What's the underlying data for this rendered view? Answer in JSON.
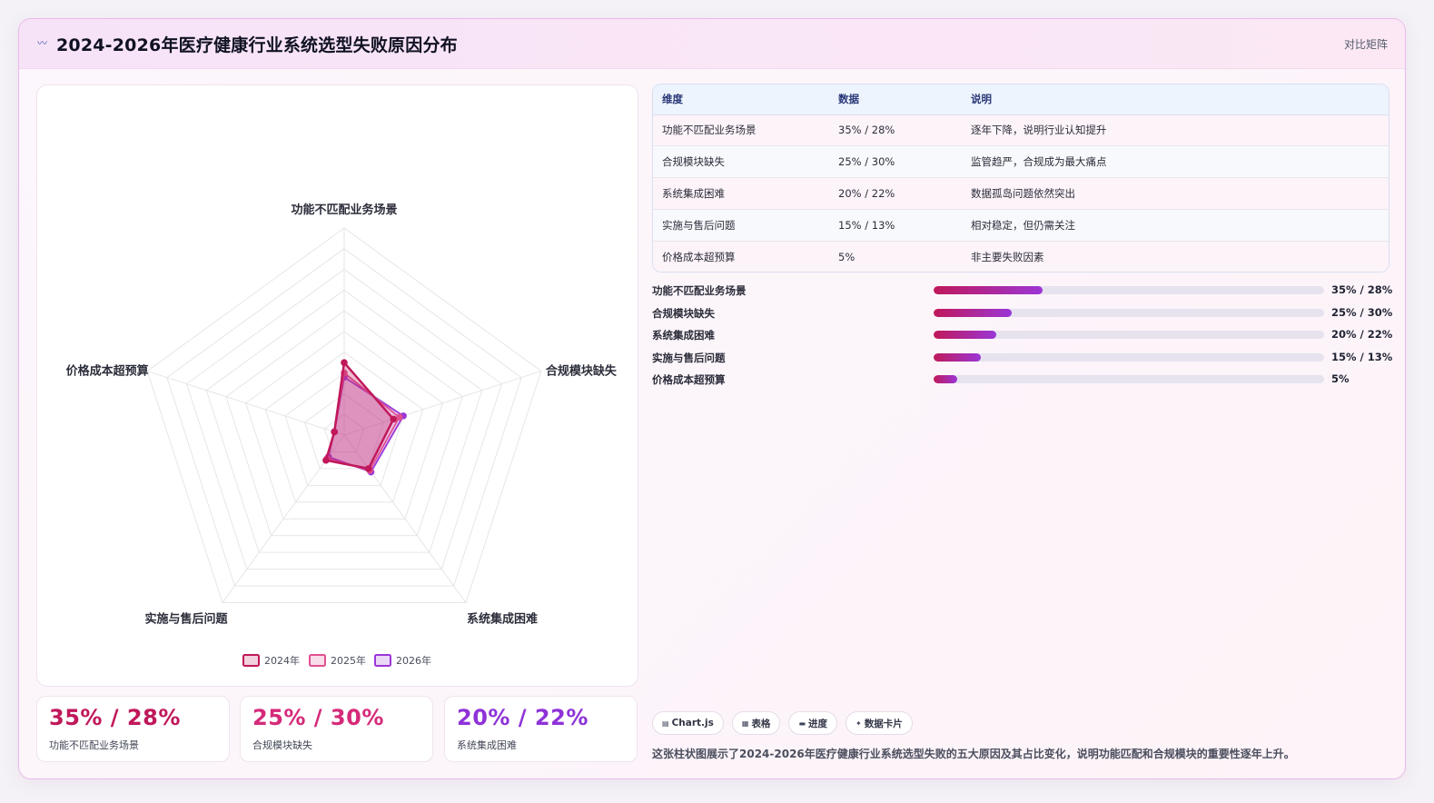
{
  "header": {
    "title": "2024-2026年医疗健康行业系统选型失败原因分布",
    "badge": "对比矩阵",
    "logo_icon": "wave-icon"
  },
  "chart_data": {
    "type": "radar",
    "categories": [
      "功能不匹配业务场景",
      "合规模块缺失",
      "系统集成困难",
      "实施与售后问题",
      "价格成本超预算"
    ],
    "series": [
      {
        "name": "2024年",
        "values": [
          35,
          25,
          20,
          15,
          5
        ],
        "color": "#c0185a"
      },
      {
        "name": "2025年",
        "values": [
          30,
          28,
          21,
          14,
          5
        ],
        "color": "#e0508f"
      },
      {
        "name": "2026年",
        "values": [
          28,
          30,
          22,
          13,
          5
        ],
        "color": "#9b36d6"
      }
    ],
    "rlim": [
      0,
      100
    ],
    "grid": true,
    "legend_position": "bottom"
  },
  "stats": [
    {
      "value": "35% / 28%",
      "label": "功能不匹配业务场景",
      "color": "#c0185a"
    },
    {
      "value": "25% / 30%",
      "label": "合规模块缺失",
      "color": "#d52a7a"
    },
    {
      "value": "20% / 22%",
      "label": "系统集成困难",
      "color": "#8e32d8"
    }
  ],
  "table": {
    "headers": [
      "维度",
      "数据",
      "说明"
    ],
    "rows": [
      [
        "功能不匹配业务场景",
        "35% / 28%",
        "逐年下降，说明行业认知提升"
      ],
      [
        "合规模块缺失",
        "25% / 30%",
        "监管趋严，合规成为最大痛点"
      ],
      [
        "系统集成困难",
        "20% / 22%",
        "数据孤岛问题依然突出"
      ],
      [
        "实施与售后问题",
        "15% / 13%",
        "相对稳定，但仍需关注"
      ],
      [
        "价格成本超预算",
        "5%",
        "非主要失败因素"
      ]
    ]
  },
  "progress": [
    {
      "label": "功能不匹配业务场景",
      "value": "35% / 28%",
      "fraction": 0.28
    },
    {
      "label": "合规模块缺失",
      "value": "25% / 30%",
      "fraction": 0.2
    },
    {
      "label": "系统集成困难",
      "value": "20% / 22%",
      "fraction": 0.16
    },
    {
      "label": "实施与售后问题",
      "value": "15% / 13%",
      "fraction": 0.12
    },
    {
      "label": "价格成本超预算",
      "value": "5%",
      "fraction": 0.06
    }
  ],
  "chips": [
    {
      "icon": "chart-icon",
      "glyph": "▤",
      "label": "Chart.js"
    },
    {
      "icon": "table-icon",
      "glyph": "▦",
      "label": "表格"
    },
    {
      "icon": "progress-icon",
      "glyph": "▬",
      "label": "进度"
    },
    {
      "icon": "sparkle-icon",
      "glyph": "✦",
      "label": "数据卡片"
    }
  ],
  "description": "这张柱状图展示了2024-2026年医疗健康行业系统选型失败的五大原因及其占比变化，说明功能匹配和合规模块的重要性逐年上升。"
}
